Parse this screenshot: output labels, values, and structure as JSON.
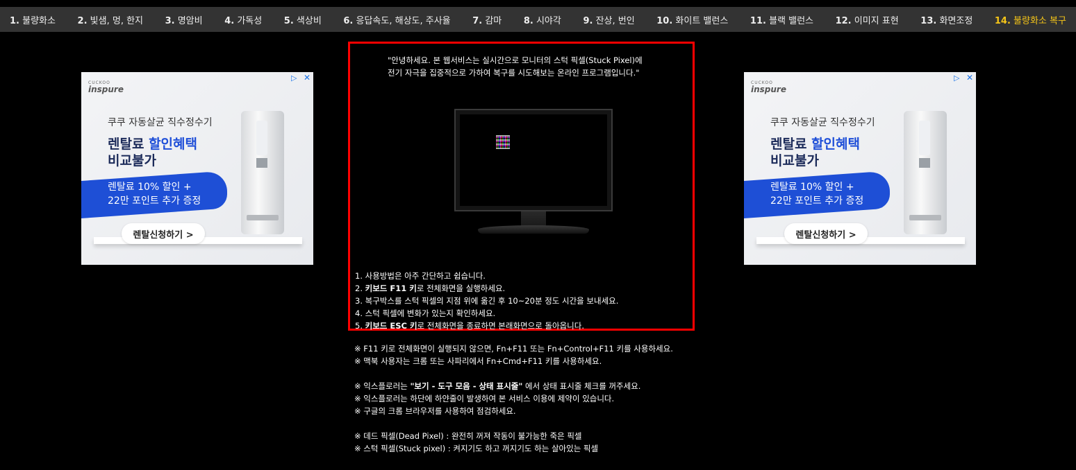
{
  "nav": {
    "items": [
      {
        "num": "1.",
        "label": "불량화소"
      },
      {
        "num": "2.",
        "label": "빛샘, 멍, 한지"
      },
      {
        "num": "3.",
        "label": "명암비"
      },
      {
        "num": "4.",
        "label": "가독성"
      },
      {
        "num": "5.",
        "label": "색상비"
      },
      {
        "num": "6.",
        "label": "응답속도, 해상도, 주사율"
      },
      {
        "num": "7.",
        "label": "감마"
      },
      {
        "num": "8.",
        "label": "시야각"
      },
      {
        "num": "9.",
        "label": "잔상, 번인"
      },
      {
        "num": "10.",
        "label": "화이트 밸런스"
      },
      {
        "num": "11.",
        "label": "블랙 밸런스"
      },
      {
        "num": "12.",
        "label": "이미지 표현"
      },
      {
        "num": "13.",
        "label": "화면조정"
      },
      {
        "num": "14.",
        "label": "불량화소 복구"
      }
    ],
    "active_color": "#f5c518"
  },
  "ad": {
    "brand_small": "CUCKOO",
    "brand": "inspure",
    "subtitle": "쿠쿠 자동살균 직수정수기",
    "headline_1a": "렌탈료 ",
    "headline_1b": "할인혜택",
    "headline_2": "비교불가",
    "promo_1": "렌탈료 10% 할인 +",
    "promo_2": "22만 포인트 추가 증정",
    "cta": "렌탈신청하기 >",
    "adchoice_icon": "adchoices-icon",
    "close_icon": "close-icon"
  },
  "main": {
    "intro_1": "\"안녕하세요. 본 웹서비스는 실시간으로 모니터의 스턱 픽셀(Stuck Pixel)에",
    "intro_2": "전기 자극을 집중적으로 가하여 복구를 시도해보는 온라인 프로그램입니다.\"",
    "steps": {
      "s1": "1. 사용방법은 아주 간단하고 쉽습니다.",
      "s2_pre": "2. ",
      "s2_bold": "키보드 F11 키",
      "s2_post": "로 전체화면을 실행하세요.",
      "s3": "3. 복구박스를 스턱 픽셀의 지점 위에 옮긴 후 10~20분 정도 시간을 보내세요.",
      "s4": "4. 스턱 픽셀에 변화가 있는지 확인하세요.",
      "s5_pre": "5. ",
      "s5_bold": "키보드 ESC 키",
      "s5_post": "로 전체화면을 종료하면 본래화면으로 돌아옵니다."
    },
    "border_color": "#ff0000"
  },
  "notes": {
    "n1": "※ F11 키로 전체화면이 실행되지 않으면, Fn+F11 또는 Fn+Control+F11 키를 사용하세요.",
    "n2": "※ 맥북 사용자는 크롬 또는 사파리에서 Fn+Cmd+F11 키를 사용하세요.",
    "n3_pre": "※ 익스플로러는 ",
    "n3_bold": "\"보기 - 도구 모음 - 상태 표시줄\"",
    "n3_post": " 에서 상태 표시줄 체크를 꺼주세요.",
    "n4": "※ 익스플로러는 하단에 하얀줄이 발생하여 본 서비스 이용에 제약이 있습니다.",
    "n5": "※ 구글의 크롬 브라우저를 사용하여 점검하세요.",
    "n6": "※ 데드 픽셀(Dead Pixel) : 완전히 꺼져 작동이 불가능한 죽은 픽셀",
    "n7": "※ 스턱 픽셀(Stuck pixel) : 켜지기도 하고 꺼지기도 하는 살아있는 픽셀"
  }
}
